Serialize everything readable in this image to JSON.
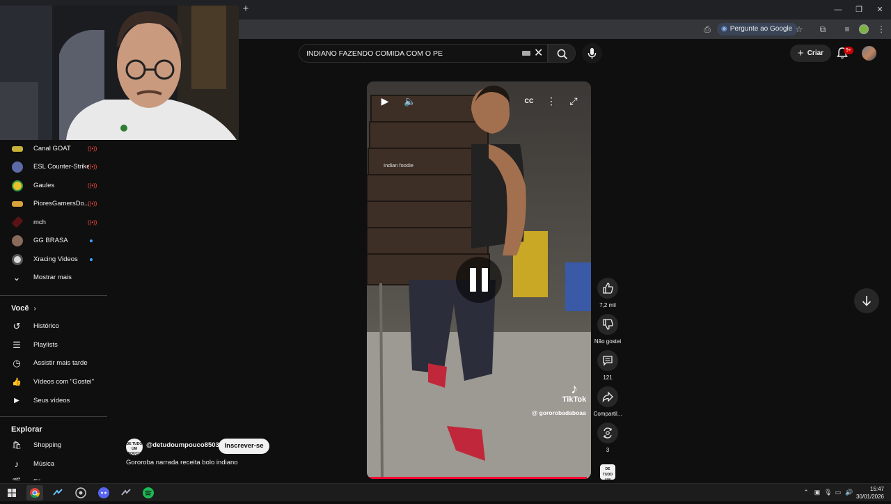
{
  "browser": {
    "new_tab_glyph": "+",
    "ask_google": "Pergunte ao Google",
    "window_controls": [
      "—",
      "❐",
      "✕"
    ]
  },
  "search": {
    "query": "INDIANO FAZENDO COMIDA COM O PE",
    "clear_glyph": "✕"
  },
  "header": {
    "create_label": "Criar",
    "notifications_badge": "9+"
  },
  "sidebar": {
    "subscriptions": [
      {
        "label": "Canal GOAT",
        "indicator": "live",
        "color": "#c9b23a"
      },
      {
        "label": "ESL Counter-Strike",
        "indicator": "live",
        "color": "#5c6ba8"
      },
      {
        "label": "Gaules",
        "indicator": "live",
        "color": "#e8c22a"
      },
      {
        "label": "PioresGamersDo...",
        "indicator": "live",
        "color": "#d9a23b"
      },
      {
        "label": "mch",
        "indicator": "live",
        "color": "#a0262a"
      },
      {
        "label": "GG BRASA",
        "indicator": "dot",
        "color": "#8a6a5a"
      },
      {
        "label": "Xracing Videos",
        "indicator": "dot",
        "color": "#d8d8d8"
      }
    ],
    "show_more": "Mostrar mais",
    "you_heading": "Você",
    "you_items": [
      {
        "label": "Histórico",
        "icon": "history-icon",
        "glyph": "↺"
      },
      {
        "label": "Playlists",
        "icon": "playlists-icon",
        "glyph": "☰"
      },
      {
        "label": "Assistir mais tarde",
        "icon": "watch-later-icon",
        "glyph": "◷"
      },
      {
        "label": "Vídeos com \"Gostei\"",
        "icon": "like-icon",
        "glyph": "👍"
      },
      {
        "label": "Seus vídeos",
        "icon": "your-videos-icon",
        "glyph": "▶"
      }
    ],
    "explore_heading": "Explorar",
    "explore_items": [
      {
        "label": "Shopping",
        "icon": "shopping-icon",
        "glyph": "🛍"
      },
      {
        "label": "Música",
        "icon": "music-icon",
        "glyph": "♪"
      },
      {
        "label": "Filmes",
        "icon": "movies-icon",
        "glyph": "🎬"
      }
    ]
  },
  "video": {
    "overlay_text": "Indian foodie",
    "tiktok_label": "TikTok",
    "tiktok_handle": "@ gororobadaboaa",
    "progress": 0.98
  },
  "actions": {
    "likes": "7,2 mil",
    "dislike": "Não gostei",
    "comments": "121",
    "share": "Compartil...",
    "remix": "3"
  },
  "channel": {
    "handle": "@detudoumpouco8503",
    "subscribe": "Inscrever-se",
    "title": "Gororoba narrada receita bolo indiano",
    "avatar_text": "DE TUDO UM POUCO"
  },
  "taskbar": {
    "time": "15:47",
    "date": "30/01/2026"
  },
  "colors": {
    "background": "#0f0f0f",
    "live_red": "#ff4e45",
    "new_dot": "#3ea6ff",
    "progress_red": "#ff0033"
  }
}
